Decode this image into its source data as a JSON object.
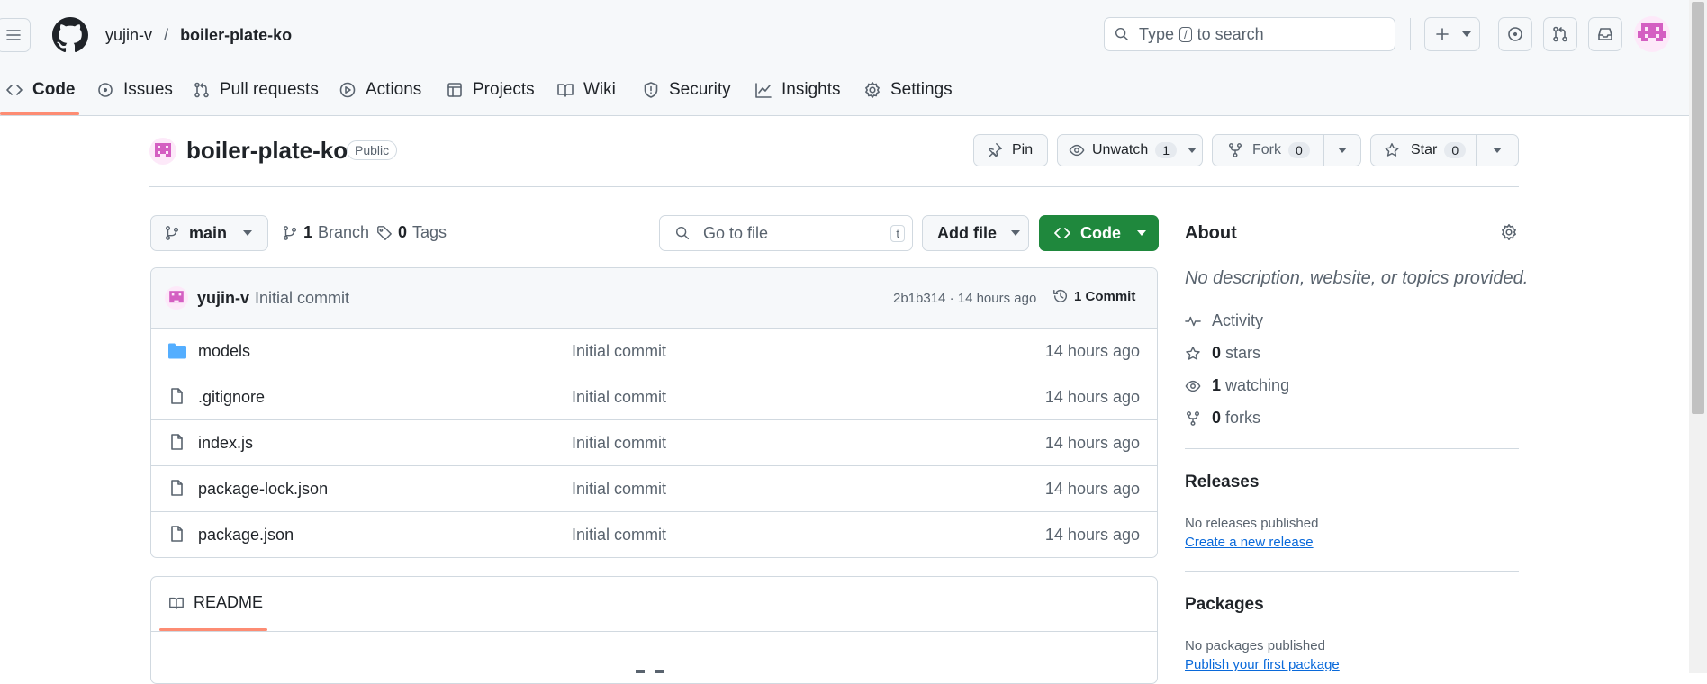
{
  "header": {
    "owner": "yujin-v",
    "separator": "/",
    "repo": "boiler-plate-ko",
    "search_prefix": "Type",
    "search_key": "/",
    "search_suffix": "to search"
  },
  "tabs": [
    {
      "label": "Code",
      "icon": "code-icon",
      "active": true
    },
    {
      "label": "Issues",
      "icon": "issue-icon"
    },
    {
      "label": "Pull requests",
      "icon": "pull-request-icon"
    },
    {
      "label": "Actions",
      "icon": "play-icon"
    },
    {
      "label": "Projects",
      "icon": "table-icon"
    },
    {
      "label": "Wiki",
      "icon": "book-icon"
    },
    {
      "label": "Security",
      "icon": "shield-icon"
    },
    {
      "label": "Insights",
      "icon": "graph-icon"
    },
    {
      "label": "Settings",
      "icon": "gear-icon"
    }
  ],
  "repo_header": {
    "name": "boiler-plate-ko",
    "visibility": "Public",
    "pin_label": "Pin",
    "unwatch_label": "Unwatch",
    "watch_count": "1",
    "fork_label": "Fork",
    "fork_count": "0",
    "star_label": "Star",
    "star_count": "0"
  },
  "toolbar": {
    "branch": "main",
    "branch_count": "1",
    "branch_label": "Branch",
    "tag_count": "0",
    "tag_label": "Tags",
    "goto_placeholder": "Go to file",
    "goto_key": "t",
    "add_file_label": "Add file",
    "code_label": "Code"
  },
  "commit": {
    "author": "yujin-v",
    "message": "Initial commit",
    "hash_time": "2b1b314 · 14 hours ago",
    "count_label": "1 Commit"
  },
  "files": [
    {
      "name": "models",
      "type": "folder",
      "message": "Initial commit",
      "time": "14 hours ago"
    },
    {
      "name": ".gitignore",
      "type": "file",
      "message": "Initial commit",
      "time": "14 hours ago"
    },
    {
      "name": "index.js",
      "type": "file",
      "message": "Initial commit",
      "time": "14 hours ago"
    },
    {
      "name": "package-lock.json",
      "type": "file",
      "message": "Initial commit",
      "time": "14 hours ago"
    },
    {
      "name": "package.json",
      "type": "file",
      "message": "Initial commit",
      "time": "14 hours ago"
    }
  ],
  "readme": {
    "label": "README"
  },
  "about": {
    "title": "About",
    "description": "No description, website, or topics provided.",
    "activity": "Activity",
    "stars_count": "0",
    "stars_label": "stars",
    "watching_count": "1",
    "watching_label": "watching",
    "forks_count": "0",
    "forks_label": "forks"
  },
  "releases": {
    "title": "Releases",
    "empty": "No releases published",
    "link": "Create a new release"
  },
  "packages": {
    "title": "Packages",
    "empty": "No packages published",
    "link": "Publish your first package"
  },
  "colors": {
    "accent_green": "#1f883d",
    "tab_underline": "#fd8c73",
    "link": "#0969da",
    "folder": "#54aeff",
    "avatar": "#d45fc2"
  }
}
